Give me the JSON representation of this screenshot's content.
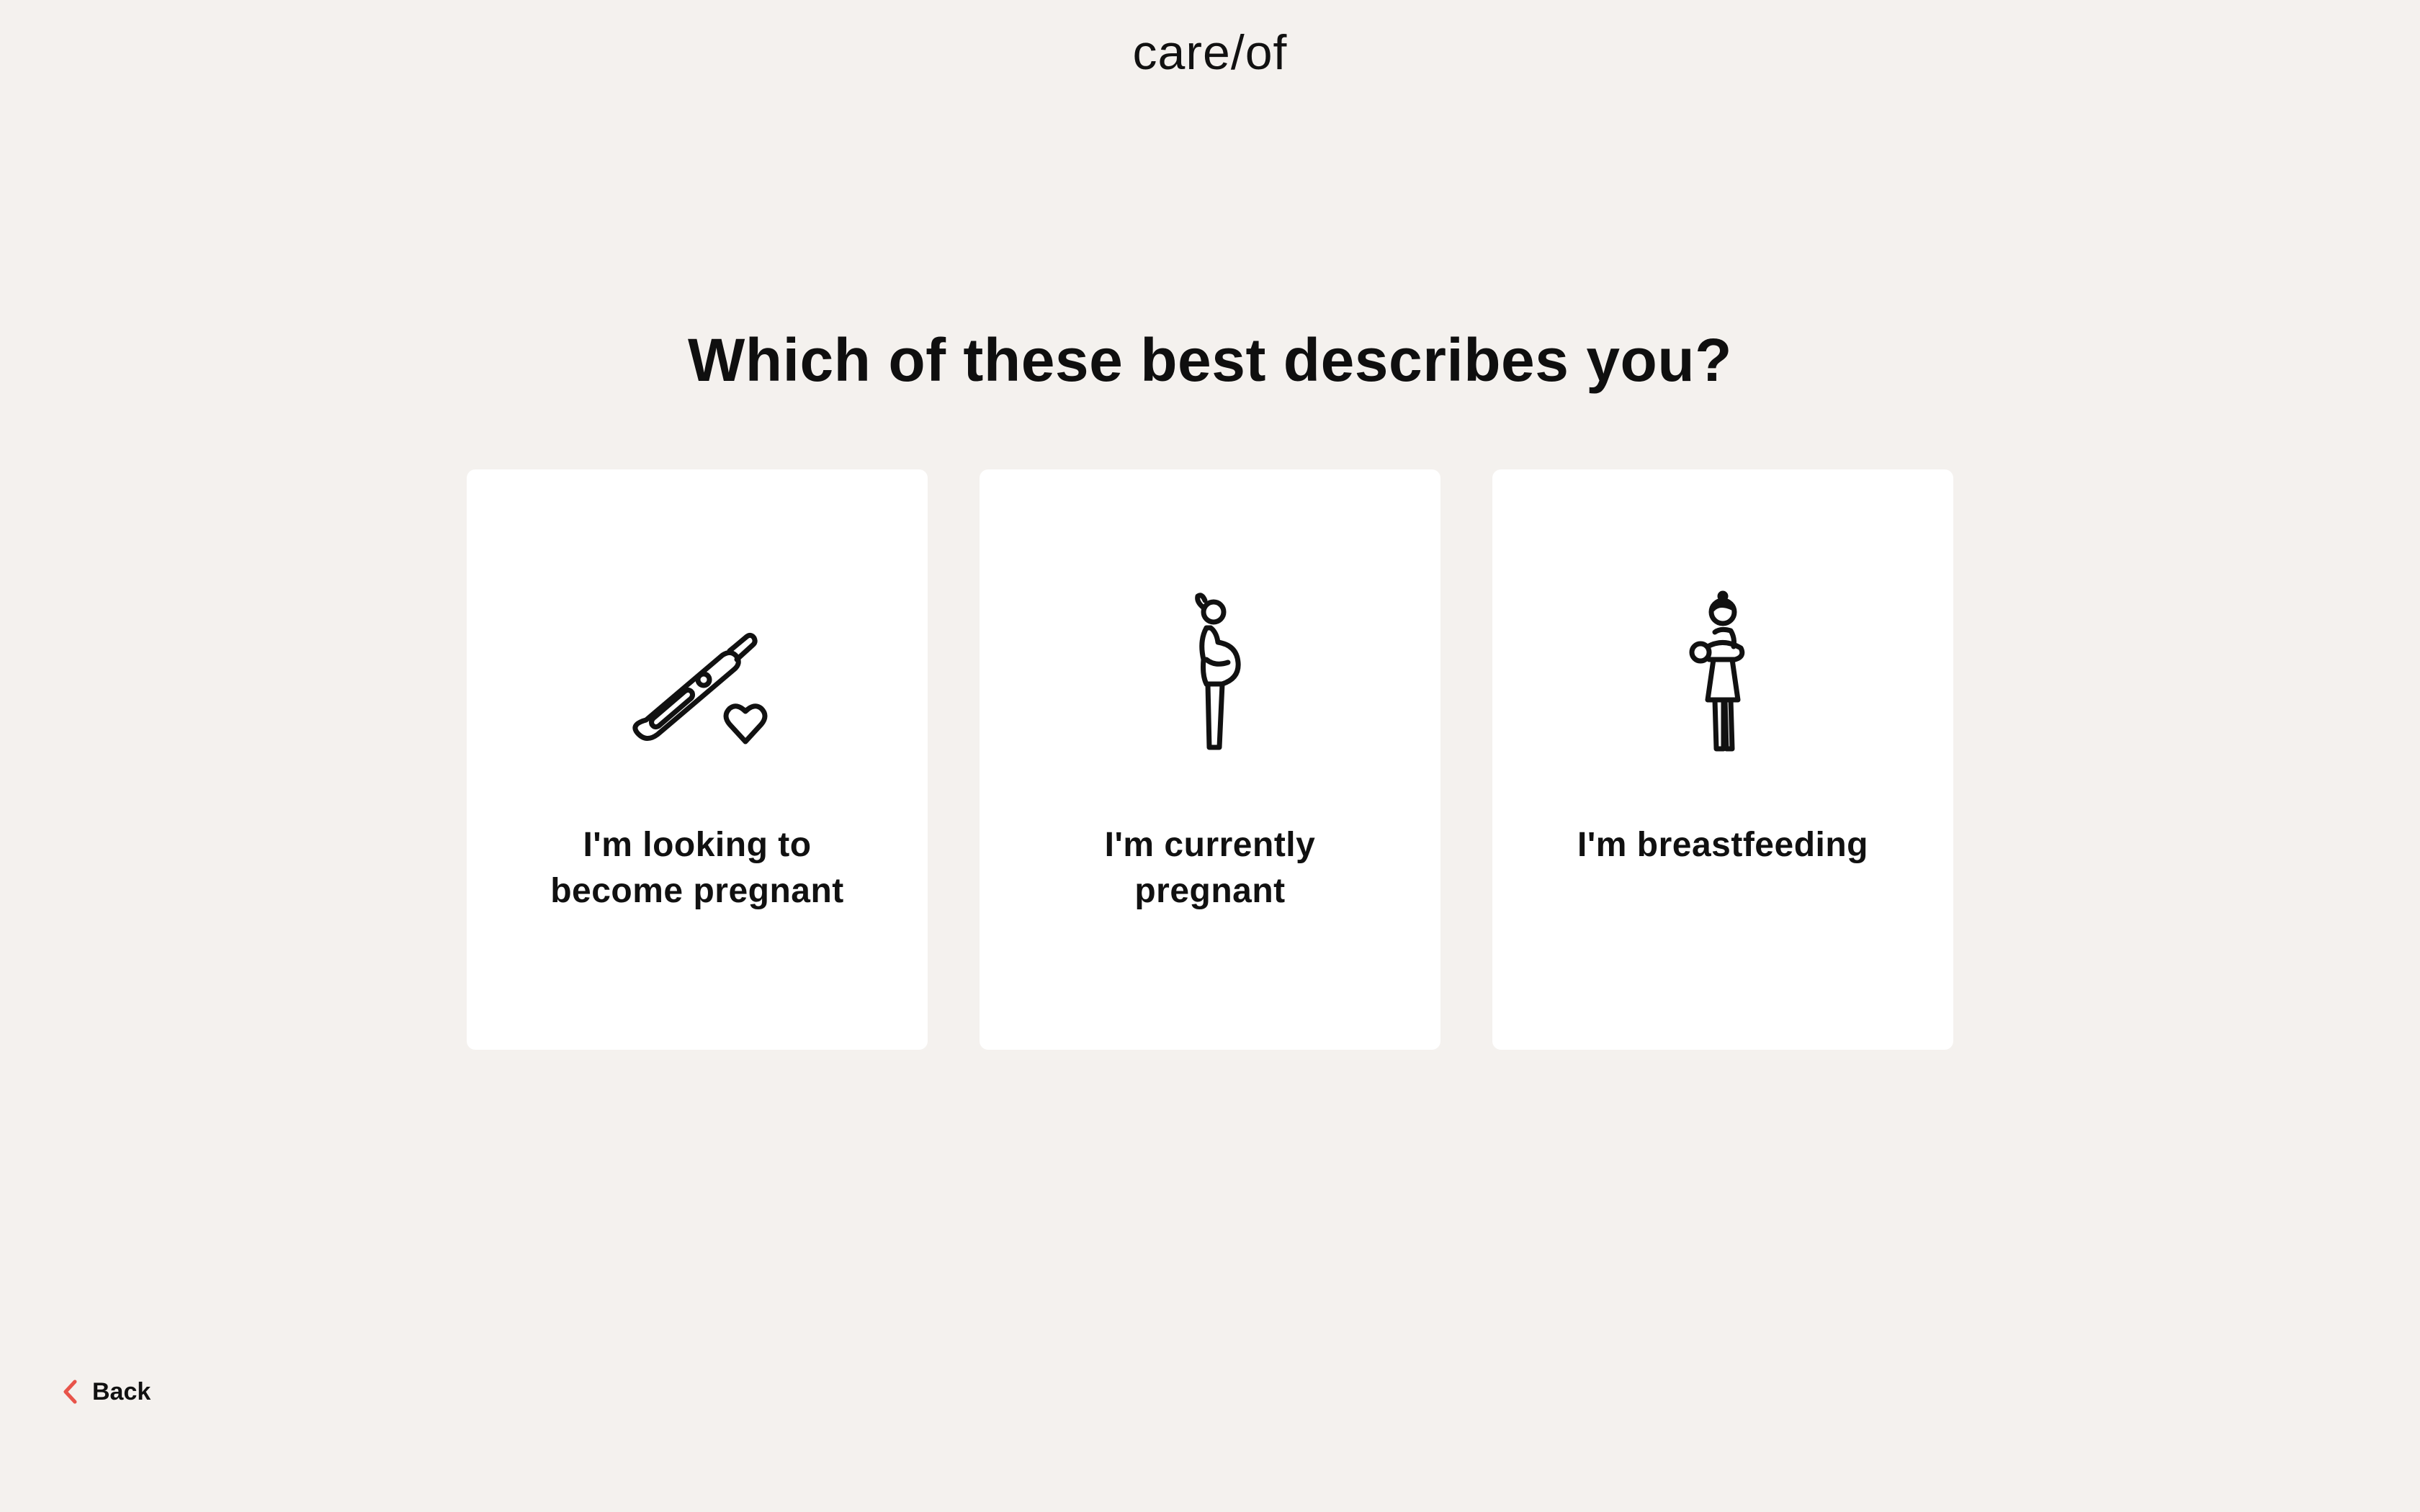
{
  "header": {
    "logo_text": "care/of"
  },
  "main": {
    "question": "Which of these best describes you?",
    "options": [
      {
        "icon": "pregnancy-test-heart-icon",
        "label_line1": "I'm looking to",
        "label_line2": "become pregnant"
      },
      {
        "icon": "pregnant-woman-icon",
        "label_line1": "I'm currently",
        "label_line2": "pregnant"
      },
      {
        "icon": "breastfeeding-woman-icon",
        "label_line1": "I'm breastfeeding",
        "label_line2": ""
      }
    ]
  },
  "footer": {
    "back_label": "Back",
    "back_icon": "chevron-left-icon"
  },
  "colors": {
    "background": "#f4f1ee",
    "card": "#ffffff",
    "text": "#111111",
    "accent": "#e8544a"
  }
}
